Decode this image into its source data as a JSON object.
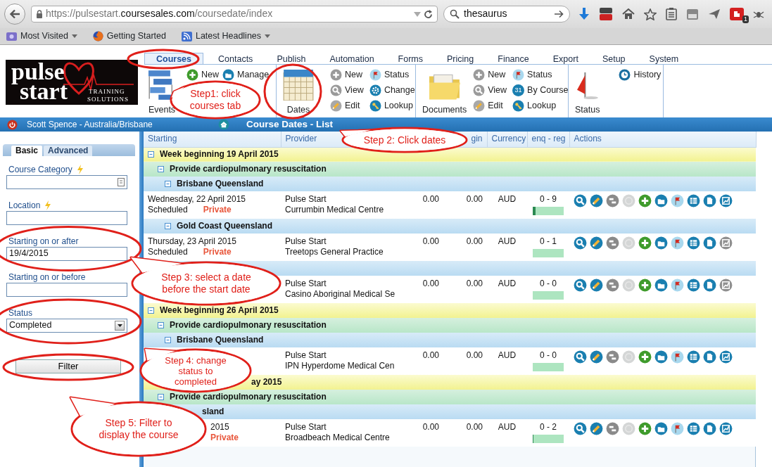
{
  "browser": {
    "url": {
      "prefix": "https://pulsestart.",
      "domain": "coursesales.com",
      "path": "/coursedate/index"
    },
    "search": "thesaurus",
    "addon_badge": "1",
    "bookmarks": [
      {
        "label": "Most Visited",
        "kind": "folder",
        "dropdown": true
      },
      {
        "label": "Getting Started",
        "kind": "firefox",
        "dropdown": false
      },
      {
        "label": "Latest Headlines",
        "kind": "feed",
        "dropdown": true
      }
    ]
  },
  "logo": {
    "line_1": "pulse",
    "line_2": "start",
    "tagline_1": "TRAINING",
    "tagline_2": "SOLUTIONS"
  },
  "menu": [
    {
      "label": "Courses",
      "selected": true
    },
    {
      "label": "Contacts",
      "selected": false
    },
    {
      "label": "Publish",
      "selected": false
    },
    {
      "label": "Automation",
      "selected": false
    },
    {
      "label": "Forms",
      "selected": false
    },
    {
      "label": "Pricing",
      "selected": false
    },
    {
      "label": "Finance",
      "selected": false
    },
    {
      "label": "Export",
      "selected": false
    },
    {
      "label": "Setup",
      "selected": false
    },
    {
      "label": "System",
      "selected": false
    }
  ],
  "ribbon": [
    {
      "large": {
        "label": "Events",
        "kind": "events"
      },
      "actions": [
        {
          "label": "New",
          "kind": "add"
        },
        {
          "label": "Manage",
          "kind": "manage"
        }
      ]
    },
    {
      "large": {
        "label": "Dates",
        "kind": "dates"
      },
      "actions": [
        {
          "label": "New",
          "kind": "new"
        },
        {
          "label": "View",
          "kind": "view"
        },
        {
          "label": "Edit",
          "kind": "edit"
        },
        {
          "label": "Status",
          "kind": "status"
        },
        {
          "label": "Change",
          "kind": "change"
        },
        {
          "label": "Lookup",
          "kind": "lookup"
        }
      ]
    },
    {
      "large": {
        "label": "Documents",
        "kind": "documents"
      },
      "actions": [
        {
          "label": "New",
          "kind": "new"
        },
        {
          "label": "View",
          "kind": "view"
        },
        {
          "label": "Edit",
          "kind": "edit"
        },
        {
          "label": "Status",
          "kind": "status"
        },
        {
          "label": "By Course",
          "kind": "bycourse",
          "badge": "31"
        },
        {
          "label": "Lookup",
          "kind": "lookup"
        }
      ]
    },
    {
      "large": {
        "label": "Status",
        "kind": "flag"
      },
      "actions": [
        {
          "label": "History",
          "kind": "history"
        }
      ]
    }
  ],
  "header_bar": {
    "user": "Scott Spence - Australia/Brisbane",
    "title": "Course Dates - List"
  },
  "filters": {
    "tabs": [
      {
        "label": "Basic",
        "selected": true
      },
      {
        "label": "Advanced",
        "selected": false
      }
    ],
    "fields": [
      {
        "label": "Course Category",
        "kind": "picker",
        "quick": true
      },
      {
        "label": "Location",
        "kind": "text",
        "quick": true
      },
      {
        "label": "Starting on or after",
        "kind": "text",
        "value": "19/4/2015",
        "quick": false
      },
      {
        "label": "Starting on or before",
        "kind": "text",
        "quick": false
      },
      {
        "label": "Status",
        "kind": "select",
        "value": "Completed",
        "quick": false
      }
    ],
    "button": "Filter"
  },
  "table": {
    "columns": [
      "Starting",
      "Provider",
      "gin",
      "Currency",
      "enq - reg",
      "Actions"
    ],
    "actions": [
      {
        "kind": "view",
        "disabled": false
      },
      {
        "kind": "edit",
        "disabled": false
      },
      {
        "kind": "move",
        "disabled": false
      },
      {
        "kind": "globe",
        "disabled": true
      },
      {
        "kind": "add",
        "disabled": false
      },
      {
        "kind": "open",
        "disabled": false
      },
      {
        "kind": "flag",
        "disabled": false
      },
      {
        "kind": "grid",
        "disabled": false
      },
      {
        "kind": "document",
        "disabled": false
      }
    ],
    "rows": [
      {
        "kind": "week",
        "label": "Week beginning 19 April 2015"
      },
      {
        "kind": "course",
        "label": "Provide cardiopulmonary resuscitation"
      },
      {
        "kind": "location",
        "label": "Brisbane Queensland"
      },
      {
        "kind": "session",
        "starting": "Wednesday, 22 April 2015",
        "status": "Scheduled",
        "visibility": "Private",
        "provider": "Pulse Start",
        "venue": "Currumbin Medical Centre",
        "amount_1": "0.00",
        "amount_2": "0.00",
        "currency": "AUD",
        "counts": "0 - 9",
        "level": 0.1,
        "report_enabled": true
      },
      {
        "kind": "location",
        "label": "Gold Coast Queensland"
      },
      {
        "kind": "session",
        "starting": "Thursday, 23 April 2015",
        "status": "Scheduled",
        "visibility": "Private",
        "provider": "Pulse Start",
        "venue": "Treetops General Practice",
        "amount_1": "0.00",
        "amount_2": "0.00",
        "currency": "AUD",
        "counts": "0 - 1",
        "level": 0,
        "report_enabled": false
      },
      {
        "kind": "location",
        "partly_hidden": true
      },
      {
        "kind": "session",
        "provider": "Pulse Start",
        "venue": "Casino Aboriginal Medical Se",
        "amount_1": "0.00",
        "amount_2": "0.00",
        "currency": "AUD",
        "counts": "0 - 0",
        "level": 0,
        "report_enabled": false
      },
      {
        "kind": "week",
        "label": "Week beginning 26 April 2015"
      },
      {
        "kind": "course",
        "label": "Provide cardiopulmonary resuscitation"
      },
      {
        "kind": "location",
        "label": "Brisbane Queensland"
      },
      {
        "kind": "session",
        "provider": "Pulse Start",
        "venue": "IPN Hyperdome Medical Cen",
        "amount_1": "0.00",
        "amount_2": "0.00",
        "currency": "AUD",
        "counts": "0 - 0",
        "level": 0,
        "report_enabled": true
      },
      {
        "kind": "week",
        "label": "ay 2015",
        "partly_hidden": true
      },
      {
        "kind": "course",
        "label": "Provide cardiopulmonary resuscitation"
      },
      {
        "kind": "location",
        "label": "sland",
        "partly_hidden": true
      },
      {
        "kind": "session",
        "starting": "2015",
        "visibility": "Private",
        "provider": "Pulse Start",
        "venue": "Broadbeach Medical Centre",
        "amount_1": "0.00",
        "amount_2": "0.00",
        "currency": "AUD",
        "counts": "0 - 2",
        "level": 0.03,
        "report_enabled": true,
        "partly_hidden": true
      }
    ]
  },
  "annotations": [
    {
      "text": "Step1: click courses tab"
    },
    {
      "text": "Step 2: Click dates"
    },
    {
      "text": "Step 3: select a date before the start date"
    },
    {
      "text": "Step 4: change status to completed"
    },
    {
      "text": "Step 5: Filter to display the course"
    }
  ]
}
